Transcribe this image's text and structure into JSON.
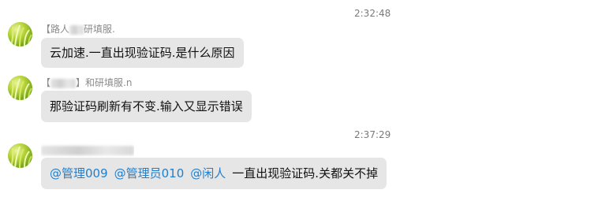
{
  "messages": [
    {
      "time": "2:32:48",
      "sender_prefix": "【路人",
      "sender_suffix": "研填服.",
      "text": "云加速.一直出现验证码.是什么原因"
    },
    {
      "time": "",
      "sender_prefix": "【",
      "sender_suffix": "】和研填服.n",
      "text": "那验证码刷新有不变.输入又显示错误"
    },
    {
      "time": "2:37:29",
      "sender_prefix": "",
      "sender_suffix": "",
      "mentions": [
        "@管理009",
        "@管理员010",
        "@闲人"
      ],
      "text": "一直出现验证码.关都关不掉"
    }
  ],
  "colors": {
    "bubble": "#e6e6e6",
    "mention": "#1f7fcf",
    "timestamp": "#7a7a7a"
  },
  "icons": {
    "avatar": "green-grass-avatar-icon"
  }
}
